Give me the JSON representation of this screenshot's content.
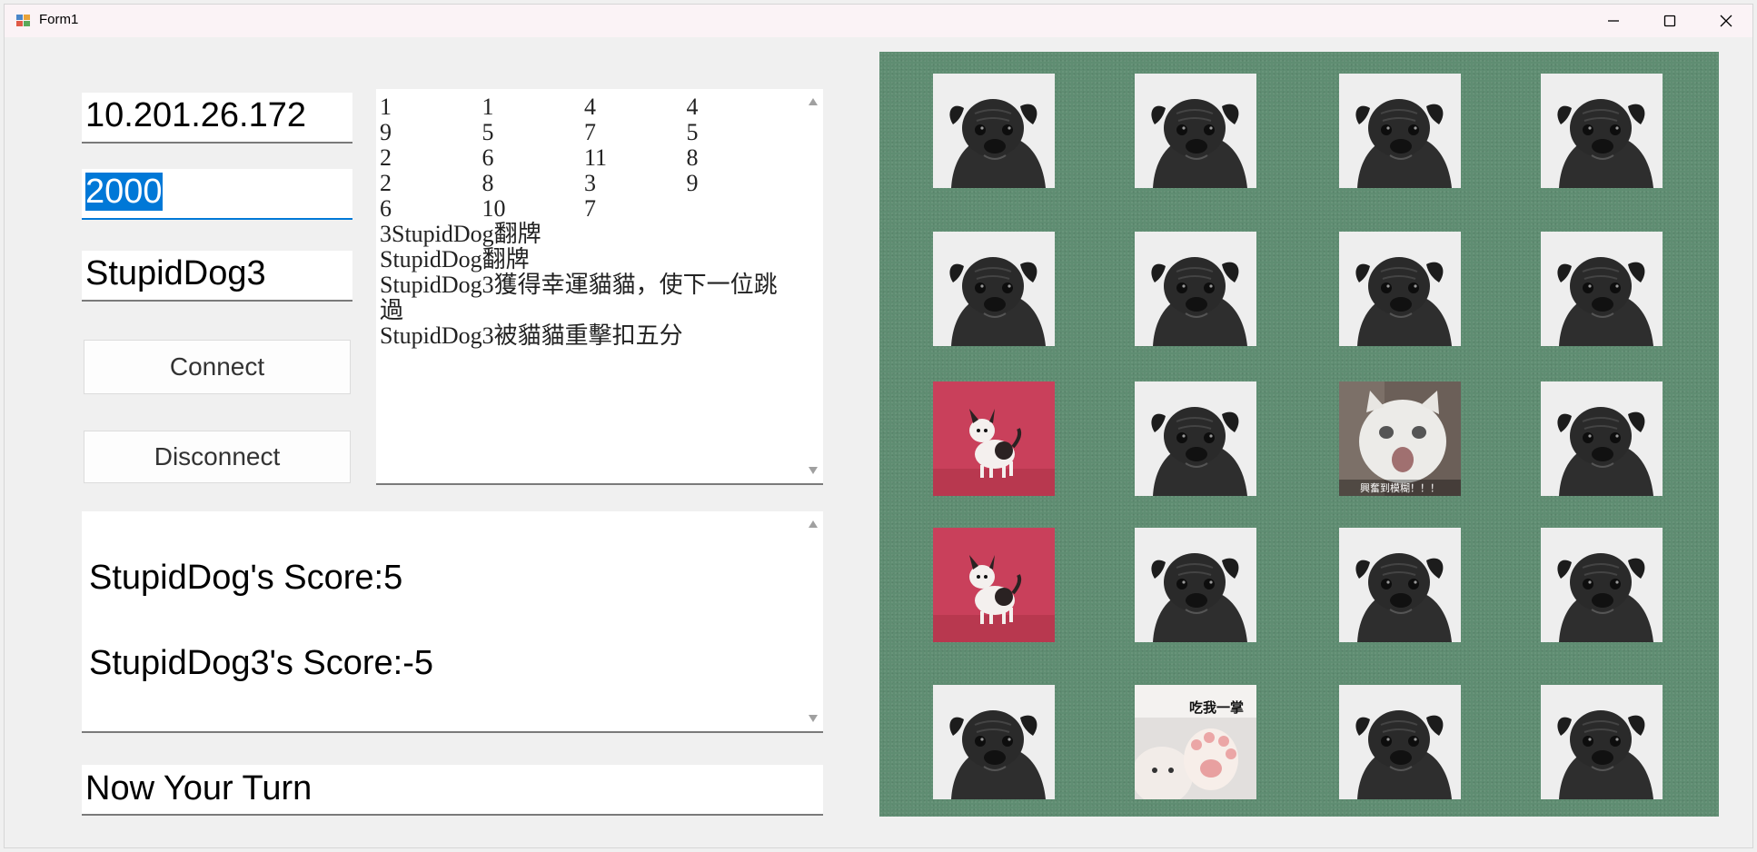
{
  "window": {
    "title": "Form1",
    "minimize_icon": "minimize-icon",
    "maximize_icon": "maximize-icon",
    "close_icon": "close-icon"
  },
  "connection": {
    "ip": "10.201.26.172",
    "port": "2000",
    "name": "StupidDog3",
    "connect_label": "Connect",
    "disconnect_label": "Disconnect"
  },
  "log": {
    "number_rows": [
      [
        "1",
        "1",
        "4",
        "4"
      ],
      [
        "9",
        "5",
        "7",
        "5"
      ],
      [
        "2",
        "6",
        "11",
        "8"
      ],
      [
        "2",
        "8",
        "3",
        "9"
      ],
      [
        "6",
        "10",
        "7",
        ""
      ]
    ],
    "lines": [
      "3StupidDog翻牌",
      "StupidDog翻牌",
      "StupidDog3獲得幸運貓貓，使下一位跳過",
      "StupidDog3被貓貓重擊扣五分"
    ]
  },
  "scores": {
    "line1": "StupidDog's Score:5",
    "line2": "StupidDog3's Score:-5"
  },
  "status": {
    "turn": "Now Your Turn"
  },
  "board": {
    "rows": [
      [
        "pug",
        "pug",
        "pug",
        "pug"
      ],
      [
        "pug",
        "pug",
        "pug",
        "pug"
      ],
      [
        "chihuahua",
        "pug",
        "cat-shocked",
        "pug"
      ],
      [
        "chihuahua",
        "pug",
        "pug",
        "pug"
      ],
      [
        "pug",
        "cat-paw",
        "pug",
        "pug"
      ]
    ],
    "cat_shocked_caption": "興奮到模糊！！！",
    "cat_paw_caption": "吃我一掌"
  },
  "colors": {
    "board_bg": "#5f8d72",
    "selection": "#0078d7",
    "chihuahua_bg": "#c9405b"
  }
}
